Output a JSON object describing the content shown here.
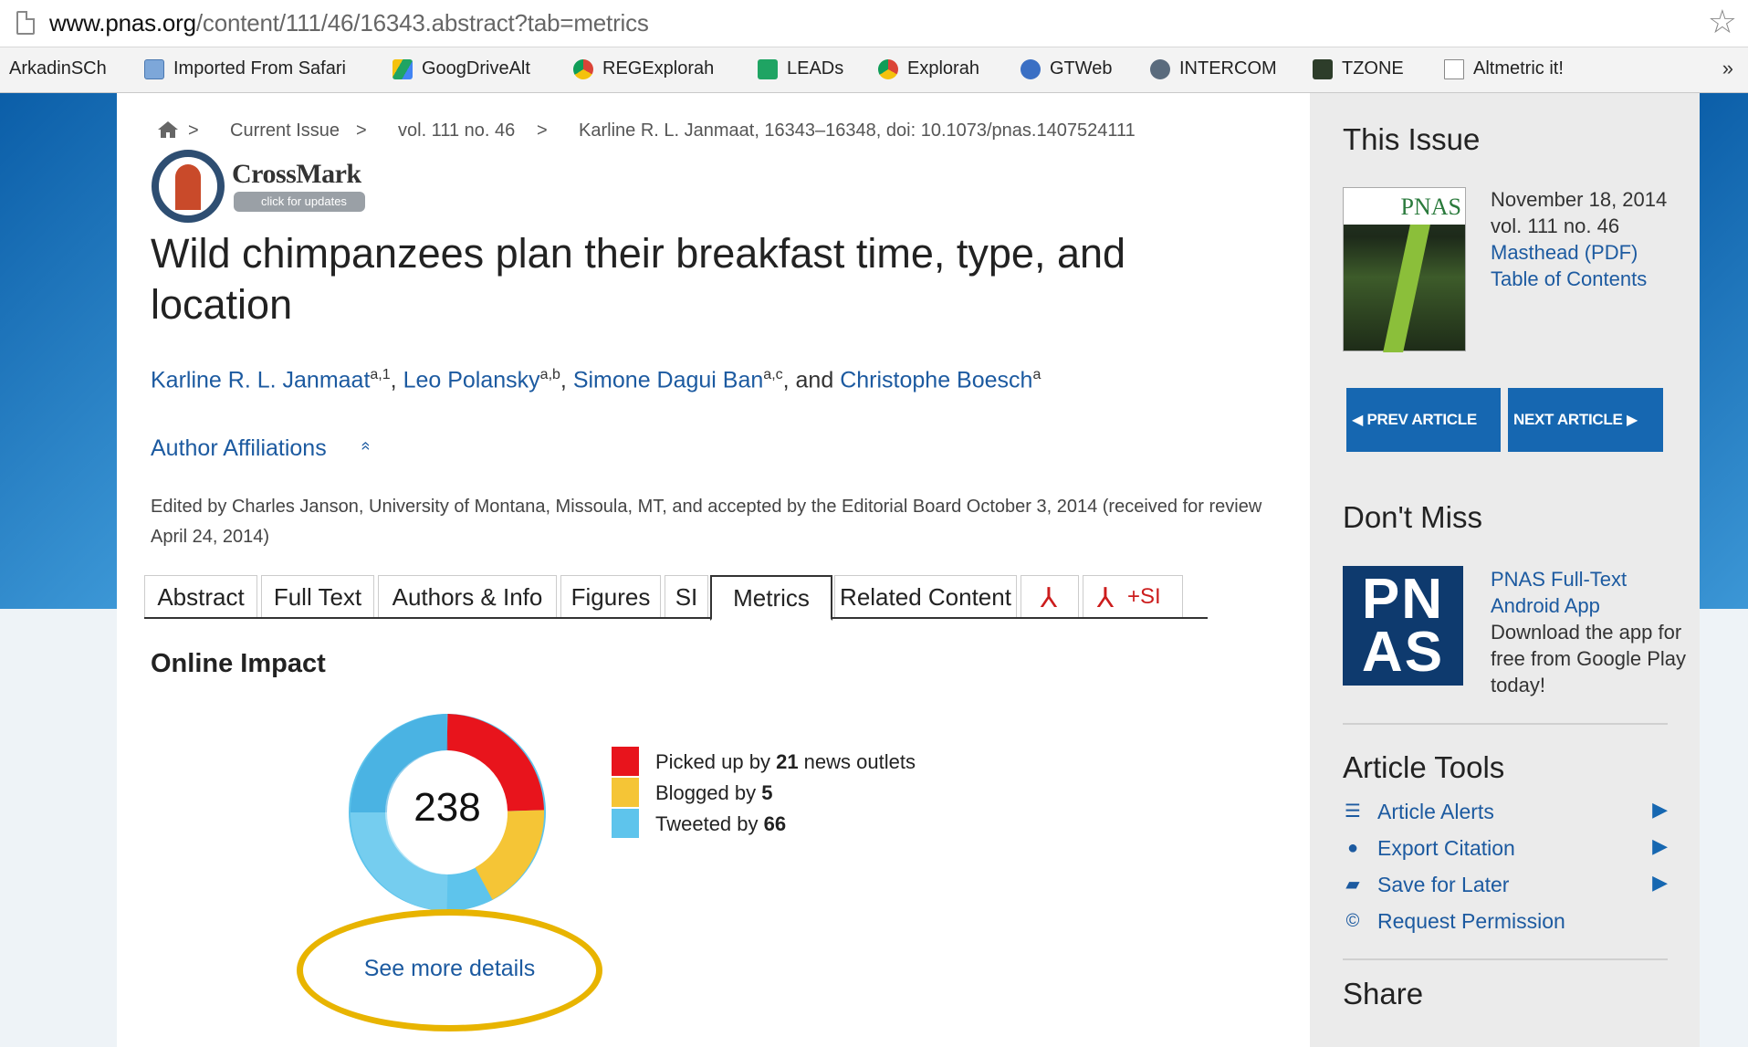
{
  "browser": {
    "url_host": "www.pnas.org",
    "url_path": "/content/111/46/16343.abstract?tab=metrics",
    "bookmarks": [
      {
        "label": "ArkadinSCh",
        "icon": "none"
      },
      {
        "label": "Imported From Safari",
        "icon": "folder-icon"
      },
      {
        "label": "GoogDriveAlt",
        "icon": "drive-icon"
      },
      {
        "label": "REGExplorah",
        "icon": "chrome-icon"
      },
      {
        "label": "LEADs",
        "icon": "sheet-icon"
      },
      {
        "label": "Explorah",
        "icon": "chrome-icon"
      },
      {
        "label": "GTWeb",
        "icon": "flower-icon"
      },
      {
        "label": "INTERCOM",
        "icon": "intercom-icon"
      },
      {
        "label": "TZONE",
        "icon": "tzone-icon"
      },
      {
        "label": "Altmetric it!",
        "icon": "page-icon"
      }
    ],
    "more": "»"
  },
  "breadcrumb": {
    "items": [
      "Current Issue",
      "vol. 111 no. 46",
      "Karline R. L. Janmaat,  16343–16348, doi: 10.1073/pnas.1407524111"
    ],
    "sep": ">"
  },
  "crossmark": {
    "title": "CrossMark",
    "subtitle": "click for updates"
  },
  "article": {
    "title": "Wild chimpanzees plan their breakfast time, type, and location",
    "authors": [
      {
        "name": "Karline R. L. Janmaat",
        "sup": "a,1"
      },
      {
        "name": "Leo Polansky",
        "sup": "a,b"
      },
      {
        "name": "Simone Dagui Ban",
        "sup": "a,c"
      },
      {
        "name": "Christophe Boesch",
        "sup": "a"
      }
    ],
    "and_text": ", and",
    "comma": ",",
    "affiliations_label": "Author Affiliations",
    "affiliations_toggle": "»",
    "edited": "Edited by Charles Janson, University of Montana, Missoula, MT, and accepted by the Editorial Board October 3, 2014 (received for review April 24, 2014)"
  },
  "tabs": [
    {
      "label": "Abstract",
      "active": false
    },
    {
      "label": "Full Text",
      "active": false
    },
    {
      "label": "Authors & Info",
      "active": false
    },
    {
      "label": "Figures",
      "active": false
    },
    {
      "label": "SI",
      "active": false
    },
    {
      "label": "Metrics",
      "active": true
    },
    {
      "label": "Related Content",
      "active": false
    }
  ],
  "pdf_si_label": "+SI",
  "metrics": {
    "heading": "Online Impact",
    "score": "238",
    "legend": [
      {
        "pre": "Picked up by ",
        "count": "21",
        "post": " news outlets",
        "color": "#e8141c"
      },
      {
        "pre": "Blogged by ",
        "count": "5",
        "post": "",
        "color": "#f5c536"
      },
      {
        "pre": "Tweeted by ",
        "count": "66",
        "post": "",
        "color": "#5ec4ec"
      }
    ],
    "see_more": "See more details"
  },
  "sidebar": {
    "this_issue": "This Issue",
    "cover_title": "PNAS",
    "issue_date": "November 18, 2014",
    "issue_vol": "vol. 111 no. 46",
    "masthead": "Masthead (PDF)",
    "toc": "Table of Contents",
    "prev": "PREV ARTICLE",
    "next": "NEXT ARTICLE",
    "dont_miss": "Don't Miss",
    "logo_line1": "PN",
    "logo_line2": "AS",
    "app_link": "PNAS Full-Text Android App",
    "app_text": "Download the app for free from Google Play today!",
    "article_tools": "Article Tools",
    "tools": [
      {
        "label": "Article Alerts",
        "icon": "rss-icon",
        "arrow": true
      },
      {
        "label": "Export Citation",
        "icon": "globe-icon",
        "arrow": true
      },
      {
        "label": "Save for Later",
        "icon": "folder-icon",
        "arrow": true
      },
      {
        "label": "Request Permission",
        "icon": "copyright-icon",
        "arrow": false
      }
    ],
    "share": "Share"
  },
  "colors": {
    "link": "#1c5aa0",
    "nav": "#1667b1",
    "highlight": "#e8b400"
  }
}
